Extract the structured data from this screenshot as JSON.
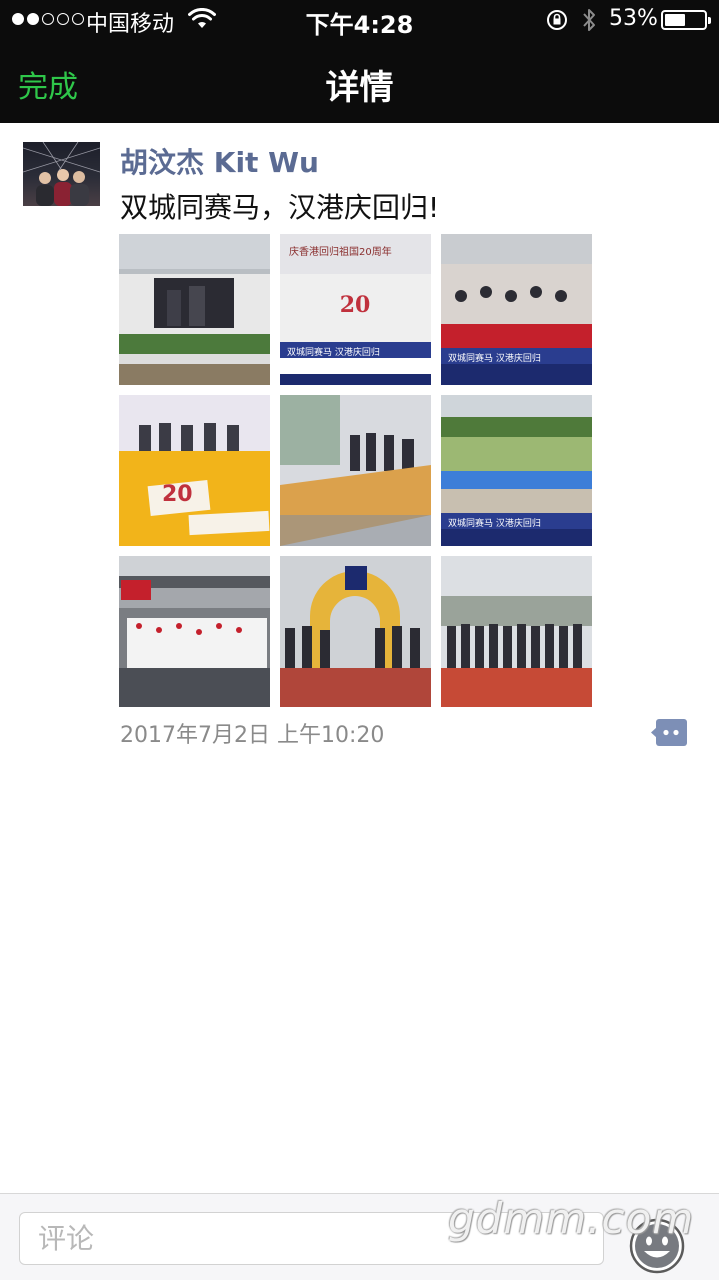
{
  "status_bar": {
    "carrier": "中国移动",
    "time": "下午4:28",
    "battery": "53%",
    "battery_level": 0.53,
    "signal_bars_filled": 2,
    "signal_bars_total": 5
  },
  "nav": {
    "done_label": "完成",
    "title": "详情"
  },
  "post": {
    "author": "胡汶杰 Kit Wu",
    "text": "双城同赛马，汉港庆回归!",
    "timestamp": "2017年7月2日 上午10:20",
    "photos": [
      {
        "caption": ""
      },
      {
        "caption": "双城同赛马 汉港庆回归",
        "headline": "庆香港回归祖国20周年"
      },
      {
        "caption": "双城同赛马 汉港庆回归"
      },
      {
        "caption": "",
        "headline": "20"
      },
      {
        "caption": ""
      },
      {
        "caption": "双城同赛马 汉港庆回归"
      },
      {
        "caption": ""
      },
      {
        "caption": ""
      },
      {
        "caption": ""
      }
    ]
  },
  "comment_bar": {
    "placeholder": "评论"
  },
  "watermark": "gdmm.com",
  "colors": {
    "nav_bg": "#0c0c0c",
    "done_green": "#2fc74a",
    "author_blue": "#5b6b93",
    "comment_icon": "#7d8fb6"
  },
  "icons": [
    "wifi-icon",
    "lock-rotation-icon",
    "bluetooth-icon",
    "battery-icon",
    "comment-icon",
    "emoji-icon"
  ]
}
